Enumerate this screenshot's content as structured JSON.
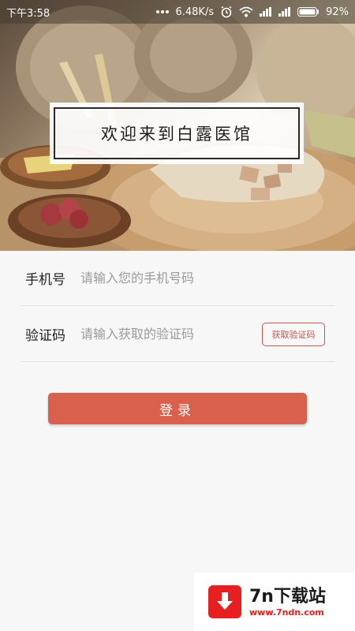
{
  "status_bar": {
    "time": "下午3:58",
    "speed": "6.48K/s",
    "battery": "92%",
    "icons": [
      "more-dots-icon",
      "alarm-icon",
      "wifi-icon",
      "signal-icon",
      "signal-icon",
      "battery-icon"
    ]
  },
  "hero": {
    "banner_text": "欢迎来到白露医馆"
  },
  "form": {
    "phone_label": "手机号",
    "phone_placeholder": "请输入您的手机号码",
    "code_label": "验证码",
    "code_placeholder": "请输入获取的验证码",
    "code_button": "获取验证码"
  },
  "login_button": "登录",
  "watermark": {
    "name": "7n下载站",
    "url": "www.7ndn.com"
  },
  "colors": {
    "accent": "#d9604c",
    "code_button": "#c0594c",
    "watermark_red": "#e62020"
  }
}
